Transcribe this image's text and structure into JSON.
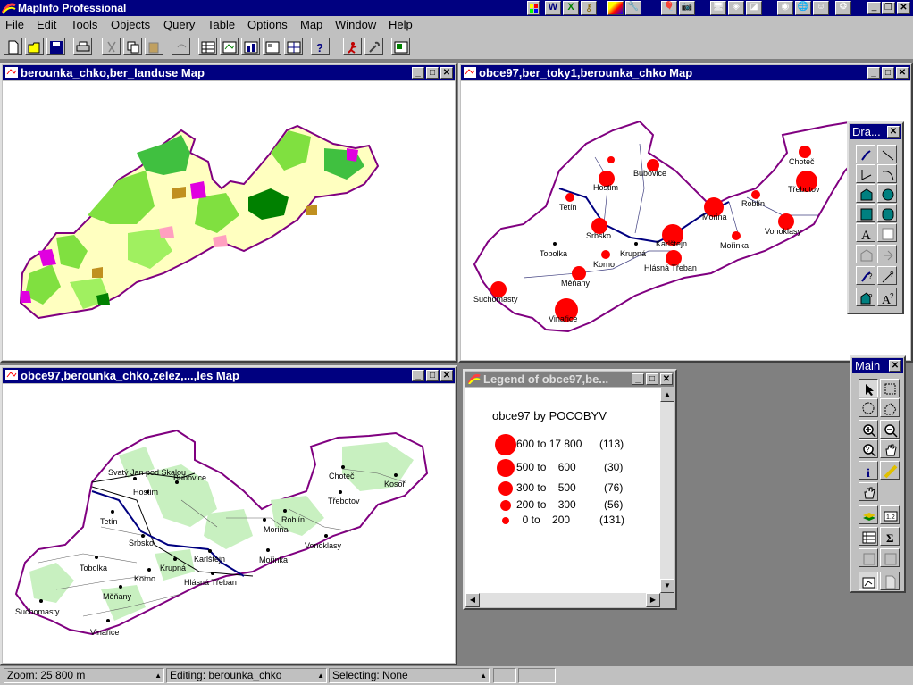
{
  "app": {
    "title": "MapInfo Professional"
  },
  "menu": [
    "File",
    "Edit",
    "Tools",
    "Objects",
    "Query",
    "Table",
    "Options",
    "Map",
    "Window",
    "Help"
  ],
  "windows": {
    "landuse": {
      "title": "berounka_chko,ber_landuse Map"
    },
    "obce_toky": {
      "title": "obce97,ber_toky1,berounka_chko Map"
    },
    "obce_zelez": {
      "title": "obce97,berounka_chko,zelez,...,les Map"
    },
    "legend": {
      "title": "Legend of obce97,be..."
    }
  },
  "legend": {
    "heading": "obce97 by POCOBYV",
    "rows": [
      {
        "range": "600 to 17 800",
        "count": "(113)"
      },
      {
        "range": "500 to    600",
        "count": "(30)"
      },
      {
        "range": "300 to    500",
        "count": "(76)"
      },
      {
        "range": "200 to    300",
        "count": "(56)"
      },
      {
        "range": "  0 to    200",
        "count": "(131)"
      }
    ],
    "symbol_color": "#ff0000"
  },
  "map2_labels": [
    "Choteč",
    "Třebotov",
    "Bubovice",
    "Hostim",
    "Tetín",
    "Roblín",
    "Morina",
    "Srbsko",
    "Karlštejn",
    "Mořinka",
    "Vonoklasy",
    "Tobolka",
    "Krupná",
    "Korno",
    "Hlásná Třeban",
    "Měňany",
    "Suchomasty",
    "Vinařice"
  ],
  "map3_labels": [
    "Svatý Jan pod Skalou",
    "Bubovice",
    "Hostim",
    "Choteč",
    "Kosoř",
    "Třebotov",
    "Roblín",
    "Tetín",
    "Morina",
    "Srbsko",
    "Karlštejn",
    "Vonoklasy",
    "Mořinka",
    "Tobolka",
    "Krupná",
    "Korno",
    "Hlásná Třeban",
    "Měňany",
    "Suchomasty",
    "Vinařice"
  ],
  "palettes": {
    "drawing": {
      "title": "Dra..."
    },
    "main": {
      "title": "Main"
    }
  },
  "status": {
    "zoom": "Zoom: 25 800 m",
    "editing": "Editing: berounka_chko",
    "selecting": "Selecting: None"
  },
  "colors": {
    "titlebar": "#000080",
    "boundary": "#800080",
    "chrome": "#c0c0c0"
  }
}
